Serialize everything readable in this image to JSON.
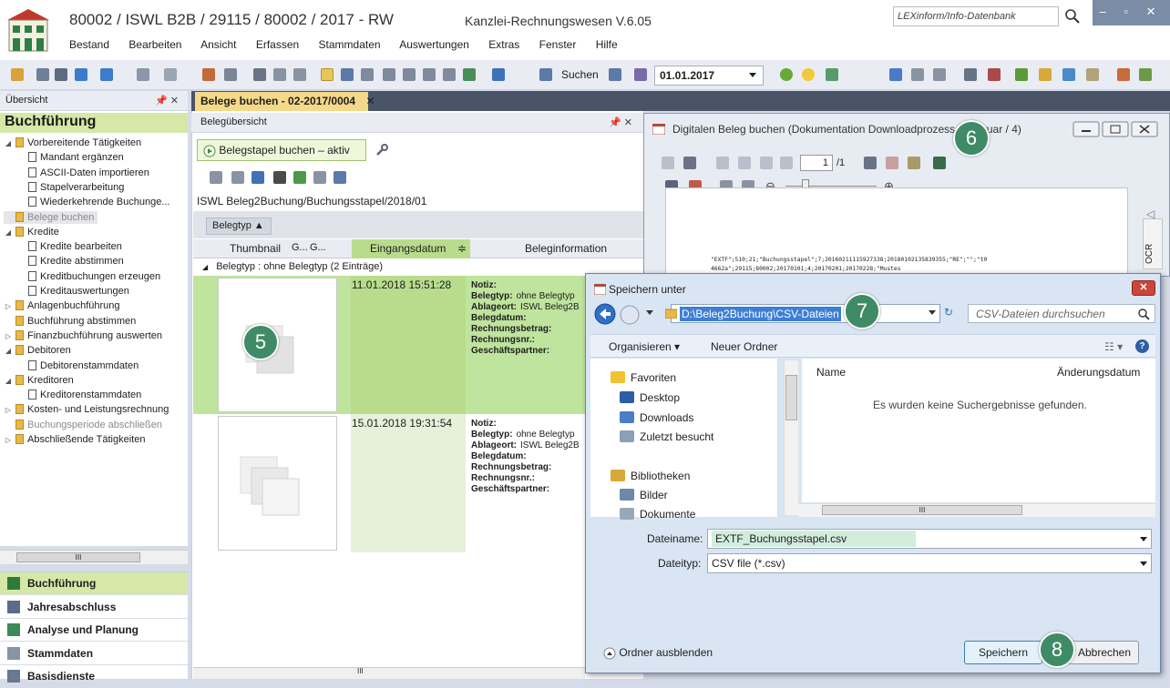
{
  "window": {
    "title": "80002 / ISWL B2B / 29115 / 80002 / 2017 - RW",
    "version": "Kanzlei-Rechnungswesen V.6.05",
    "search_placeholder": "LEXinform/Info-Datenbank",
    "controls": "– ▫ ✕"
  },
  "menu": [
    "Bestand",
    "Bearbeiten",
    "Ansicht",
    "Erfassen",
    "Stammdaten",
    "Auswertungen",
    "Extras",
    "Fenster",
    "Hilfe"
  ],
  "toolbar": {
    "search_label": "Suchen",
    "date_value": "01.01.2017"
  },
  "left_panel": {
    "header": "Übersicht",
    "header_icons": "📌 ✕",
    "title": "Buchführung",
    "tree": [
      {
        "label": "Vorbereitende Tätigkeiten",
        "level": 0,
        "type": "folder",
        "toggle": "◢"
      },
      {
        "label": "Mandant ergänzen",
        "level": 1,
        "type": "doc"
      },
      {
        "label": "ASCII-Daten importieren",
        "level": 1,
        "type": "doc"
      },
      {
        "label": "Stapelverarbeitung",
        "level": 1,
        "type": "doc"
      },
      {
        "label": "Wiederkehrende Buchunge...",
        "level": 1,
        "type": "doc"
      },
      {
        "label": "Belege buchen",
        "level": 0,
        "type": "folder",
        "grey": true,
        "selected": true
      },
      {
        "label": "Kredite",
        "level": 0,
        "type": "folder",
        "toggle": "◢"
      },
      {
        "label": "Kredite bearbeiten",
        "level": 1,
        "type": "doc"
      },
      {
        "label": "Kredite abstimmen",
        "level": 1,
        "type": "doc"
      },
      {
        "label": "Kreditbuchungen erzeugen",
        "level": 1,
        "type": "doc"
      },
      {
        "label": "Kreditauswertungen",
        "level": 1,
        "type": "doc"
      },
      {
        "label": "Anlagenbuchführung",
        "level": 0,
        "type": "folder",
        "toggle": "▷"
      },
      {
        "label": "Buchführung abstimmen",
        "level": 0,
        "type": "folder"
      },
      {
        "label": "Finanzbuchführung auswerten",
        "level": 0,
        "type": "folder",
        "toggle": "▷"
      },
      {
        "label": "Debitoren",
        "level": 0,
        "type": "folder",
        "toggle": "◢"
      },
      {
        "label": "Debitorenstammdaten",
        "level": 1,
        "type": "doc"
      },
      {
        "label": "Kreditoren",
        "level": 0,
        "type": "folder",
        "toggle": "◢"
      },
      {
        "label": "Kreditorenstammdaten",
        "level": 1,
        "type": "doc"
      },
      {
        "label": "Kosten- und Leistungsrechnung",
        "level": 0,
        "type": "folder",
        "toggle": "▷"
      },
      {
        "label": "Buchungsperiode abschließen",
        "level": 0,
        "type": "folder",
        "grey": true
      },
      {
        "label": "Abschließende Tätigkeiten",
        "level": 0,
        "type": "folder",
        "toggle": "▷"
      }
    ],
    "scroll_thumb": "III",
    "nav_sections": [
      {
        "label": "Buchführung",
        "active": true,
        "color": "#2f7a3a"
      },
      {
        "label": "Jahresabschluss",
        "active": false,
        "color": "#5a6c8c"
      },
      {
        "label": "Analyse und Planung",
        "active": false,
        "color": "#3e8a5a"
      },
      {
        "label": "Stammdaten",
        "active": false,
        "color": "#8a93a4"
      },
      {
        "label": "Basisdienste",
        "active": false,
        "color": "#6a7890"
      }
    ]
  },
  "doc_tab": {
    "label": "Belege buchen - 02-2017/0004",
    "close": "✕"
  },
  "center": {
    "header": "Belegübersicht",
    "header_icons": "📌 ✕",
    "stapel_button": "Belegstapel buchen – aktiv",
    "path": "ISWL Beleg2Buchung/Buchungsstapel/2018/01",
    "group_chip": "Belegtyp ▲",
    "columns": [
      "Thumbnail",
      "G...",
      "G...",
      "Eingangsdatum",
      "Beleginformation"
    ],
    "sort_icon": "≑",
    "group_row": "Belegtyp : ohne Belegtyp (2 Einträge)",
    "group_toggle": "◢",
    "rows": [
      {
        "date": "11.01.2018 15:51:28",
        "info": [
          [
            "Notiz:",
            ""
          ],
          [
            "Belegtyp:",
            "ohne Belegtyp"
          ],
          [
            "Ablageort:",
            "ISWL Beleg2B"
          ],
          [
            "Belegdatum:",
            ""
          ],
          [
            "Rechnungsbetrag:",
            ""
          ],
          [
            "Rechnungsnr.:",
            ""
          ],
          [
            "Geschäftspartner:",
            ""
          ]
        ]
      },
      {
        "date": "15.01.2018 19:31:54",
        "info": [
          [
            "Notiz:",
            ""
          ],
          [
            "Belegtyp:",
            "ohne Belegtyp"
          ],
          [
            "Ablageort:",
            "ISWL Beleg2B"
          ],
          [
            "Belegdatum:",
            ""
          ],
          [
            "Rechnungsbetrag:",
            ""
          ],
          [
            "Rechnungsnr.:",
            ""
          ],
          [
            "Geschäftspartner:",
            ""
          ]
        ]
      }
    ],
    "scroll_thumb": "III"
  },
  "doc_window": {
    "title": "Digitalen Beleg buchen (Dokumentation Downloadprozess / Februar / 4)",
    "page": "1",
    "page_total": "/1",
    "csv_preview": "\"EXTF\";510;21;\"Buchungsstapel\";7;20160211115927338;20180102135839355;\"RE\";\"\";\"t0",
    "csv_preview2": "4662a\";29115;80002;20170101;4;20170201;20170228;\"Mustes",
    "ocr_label": "OCR"
  },
  "save_dialog": {
    "title": "Speichern unter",
    "close": "✕",
    "path": "D:\\Beleg2Buchung\\CSV-Dateien",
    "search_placeholder": "CSV-Dateien durchsuchen",
    "organize": "Organisieren ▾",
    "new_folder": "Neuer Ordner",
    "nav": [
      {
        "label": "Favoriten",
        "color": "#f1c232"
      },
      {
        "label": "Desktop",
        "color": "#2c5ea8"
      },
      {
        "label": "Downloads",
        "color": "#4a7fc8"
      },
      {
        "label": "Zuletzt besucht",
        "color": "#8aa0b8"
      },
      {
        "label": "Bibliotheken",
        "color": "#d8a838"
      },
      {
        "label": "Bilder",
        "color": "#6d88a8"
      },
      {
        "label": "Dokumente",
        "color": "#9aa7b8"
      }
    ],
    "col_name": "Name",
    "col_date": "Änderungsdatum",
    "empty": "Es wurden keine Suchergebnisse gefunden.",
    "scroll_thumb": "III",
    "filename_label": "Dateiname:",
    "filename_value": "EXTF_Buchungsstapel.csv",
    "filetype_label": "Dateityp:",
    "filetype_value": "CSV file (*.csv)",
    "hide_folders": "Ordner ausblenden",
    "save_button": "Speichern",
    "cancel_button": "Abbrechen"
  },
  "badges": [
    "5",
    "6",
    "7",
    "8"
  ]
}
